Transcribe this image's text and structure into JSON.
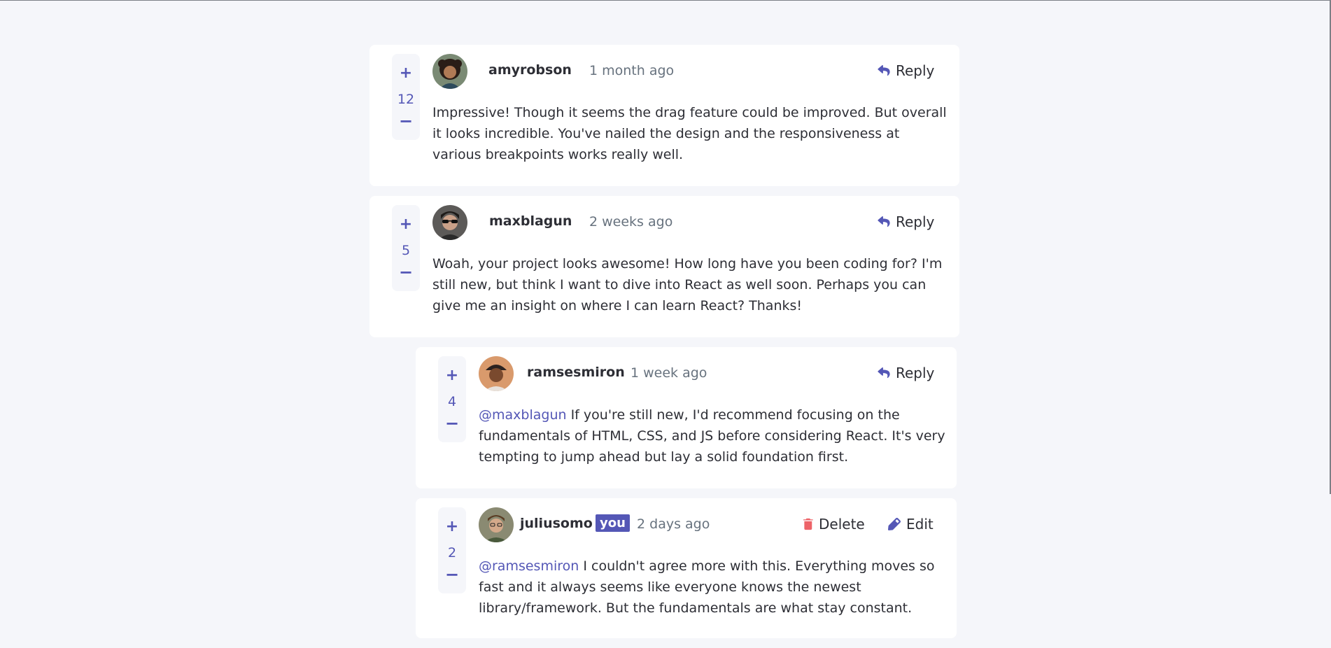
{
  "comments": [
    {
      "score": "12",
      "username": "amyrobson",
      "created_at": "1 month ago",
      "reply_label": "Reply",
      "content": "Impressive! Though it seems the drag feature could be improved. But overall it looks incredible. You've nailed the design and the responsiveness at various breakpoints works really well."
    },
    {
      "score": "5",
      "username": "maxblagun",
      "created_at": "2 weeks ago",
      "reply_label": "Reply",
      "content": "Woah, your project looks awesome! How long have you been coding for? I'm still new, but think I want to dive into React as well soon. Perhaps you can give me an insight on where I can learn React? Thanks!"
    }
  ],
  "replies": [
    {
      "score": "4",
      "username": "ramsesmiron",
      "created_at": "1 week ago",
      "reply_label": "Reply",
      "replying_to": "@maxblagun",
      "content": "If you're still new, I'd recommend focusing on the fundamentals of HTML, CSS, and JS before considering React. It's very tempting to jump ahead but lay a solid foundation first."
    },
    {
      "score": "2",
      "username": "juliusomo",
      "you_badge": "you",
      "created_at": "2 days ago",
      "delete_label": "Delete",
      "edit_label": "Edit",
      "replying_to": "@ramsesmiron",
      "content": "I couldn't agree more with this. Everything moves so fast and it always seems like everyone knows the newest library/framework. But the fundamentals are what stay constant."
    }
  ],
  "vote": {
    "plus": "+",
    "minus": "−"
  },
  "colors": {
    "accent": "#5457b6",
    "delete": "#ed6368",
    "text": "#2d2e35",
    "muted": "#67727e",
    "background": "#f5f6fa"
  },
  "icons": [
    "reply-icon",
    "delete-icon",
    "edit-icon",
    "plus-icon",
    "minus-icon"
  ]
}
